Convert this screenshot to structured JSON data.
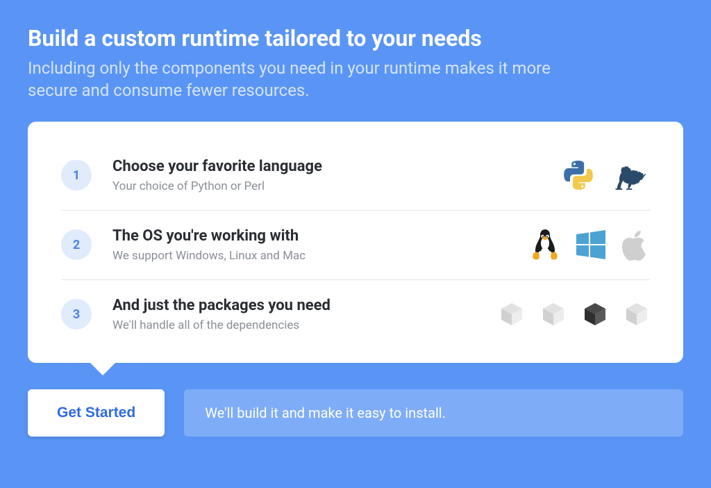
{
  "hero": {
    "title": "Build a custom runtime tailored to your needs",
    "subtitle": "Including only the components you need in your runtime makes it more secure and consume fewer resources."
  },
  "steps": [
    {
      "num": "1",
      "title": "Choose your favorite language",
      "desc": "Your choice of Python or Perl"
    },
    {
      "num": "2",
      "title": "The OS you're working with",
      "desc": "We support Windows, Linux and Mac"
    },
    {
      "num": "3",
      "title": "And just the packages you need",
      "desc": "We'll handle all of the dependencies"
    }
  ],
  "cta": {
    "button": "Get Started",
    "info": "We'll build it and make it easy to install."
  }
}
